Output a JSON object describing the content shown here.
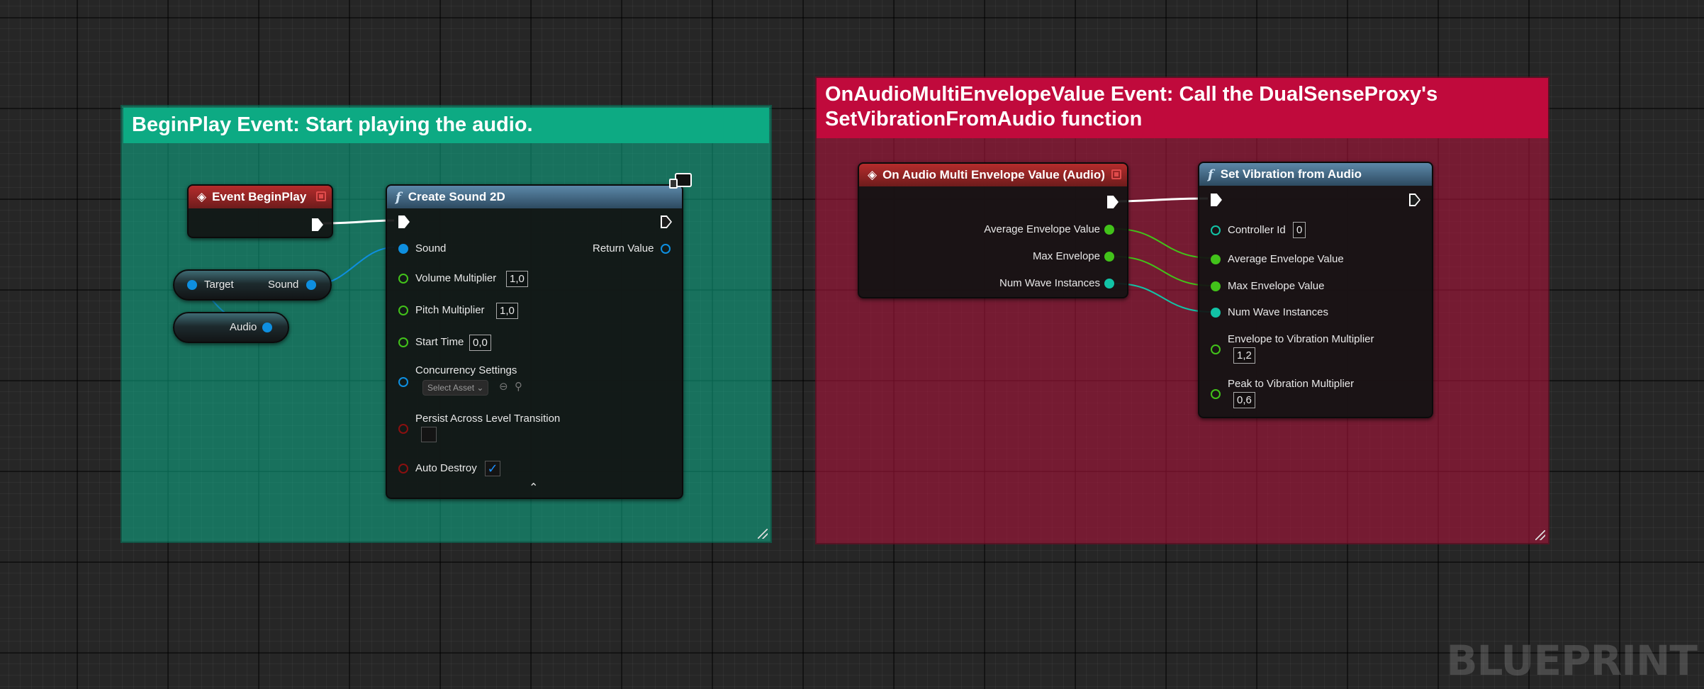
{
  "comments": {
    "begin_play": "BeginPlay Event: Start playing the audio.",
    "envelope_line1": "OnAudioMultiEnvelopeValue Event: Call the DualSenseProxy's",
    "envelope_line2": "SetVibrationFromAudio function"
  },
  "nodes": {
    "event_begin_play": {
      "title": "Event BeginPlay"
    },
    "target_sound": {
      "target_label": "Target",
      "sound_label": "Sound"
    },
    "audio_var": {
      "label": "Audio"
    },
    "create_sound_2d": {
      "title": "Create Sound 2D",
      "sound": "Sound",
      "return_value": "Return Value",
      "volume_multiplier": "Volume Multiplier",
      "volume_value": "1,0",
      "pitch_multiplier": "Pitch Multiplier",
      "pitch_value": "1,0",
      "start_time": "Start Time",
      "start_time_value": "0,0",
      "concurrency_settings": "Concurrency Settings",
      "select_asset": "Select Asset",
      "persist": "Persist Across Level Transition",
      "persist_checked": false,
      "auto_destroy": "Auto Destroy",
      "auto_destroy_checked": true
    },
    "on_audio_multi_envelope": {
      "title": "On Audio Multi Envelope Value (Audio)",
      "average_envelope": "Average Envelope Value",
      "max_envelope": "Max Envelope",
      "num_wave_instances": "Num Wave Instances"
    },
    "set_vibration": {
      "title": "Set Vibration from Audio",
      "controller_id": "Controller Id",
      "controller_id_value": "0",
      "average_envelope": "Average Envelope Value",
      "max_envelope": "Max Envelope Value",
      "num_wave_instances": "Num Wave Instances",
      "env_to_vib": "Envelope to Vibration Multiplier",
      "env_to_vib_value": "1,2",
      "peak_to_vib": "Peak to Vibration Multiplier",
      "peak_to_vib_value": "0,6"
    }
  },
  "watermark": "BLUEPRINT",
  "colors": {
    "comment_green": "#0daa83",
    "comment_red": "#c00a3c",
    "exec_wire": "#ffffff",
    "object_wire": "#0e8fe0",
    "float_wire": "#42c21a",
    "int_wire": "#12c3a6"
  }
}
